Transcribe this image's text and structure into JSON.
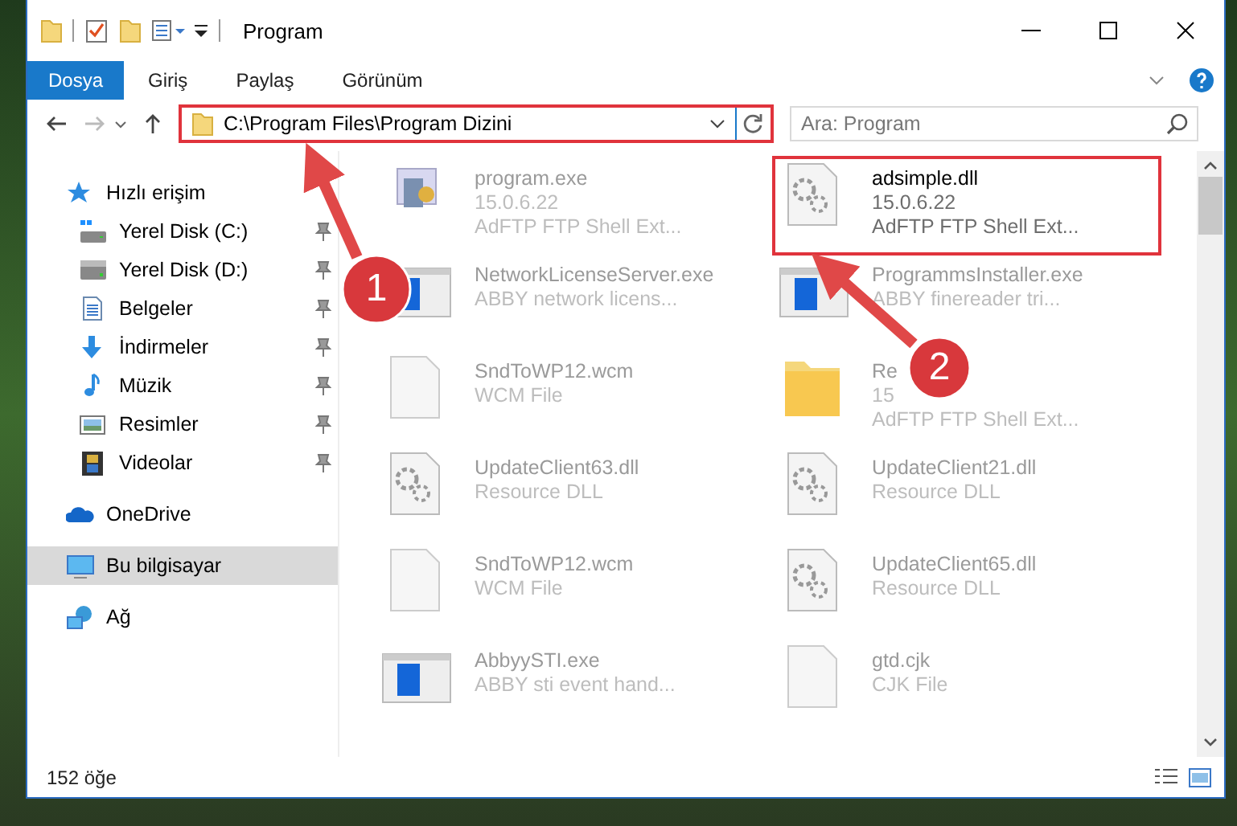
{
  "window": {
    "title": "Program"
  },
  "ribbon": {
    "tabs": [
      {
        "label": "Dosya",
        "selected": true
      },
      {
        "label": "Giriş",
        "selected": false
      },
      {
        "label": "Paylaş",
        "selected": false
      },
      {
        "label": "Görünüm",
        "selected": false
      }
    ]
  },
  "address_bar": {
    "path": "C:\\Program Files\\Program Dizini",
    "highlighted": true
  },
  "search": {
    "placeholder": "Ara: Program"
  },
  "navigation": {
    "items": [
      {
        "kind": "star",
        "label": "Hızlı erişim",
        "selected": false,
        "children": [
          {
            "kind": "drive-c",
            "label": "Yerel Disk (C:)",
            "pinned": true,
            "selected": false
          },
          {
            "kind": "drive",
            "label": "Yerel Disk (D:)",
            "pinned": true,
            "selected": false
          },
          {
            "kind": "document",
            "label": "Belgeler",
            "pinned": true,
            "selected": false
          },
          {
            "kind": "download",
            "label": "İndirmeler",
            "pinned": true,
            "selected": false
          },
          {
            "kind": "music",
            "label": "Müzik",
            "pinned": true,
            "selected": false
          },
          {
            "kind": "picture",
            "label": "Resimler",
            "pinned": true,
            "selected": false
          },
          {
            "kind": "video",
            "label": "Videolar",
            "pinned": true,
            "selected": false
          }
        ]
      },
      {
        "kind": "cloud",
        "label": "OneDrive",
        "selected": false
      },
      {
        "kind": "computer",
        "label": "Bu bilgisayar",
        "selected": true
      },
      {
        "kind": "network",
        "label": "Ağ",
        "selected": false
      }
    ]
  },
  "files": [
    {
      "kind": "program",
      "name": "program.exe",
      "details": [
        "15.0.6.22",
        "AdFTP FTP Shell Ext..."
      ],
      "faded": true,
      "highlighted": false
    },
    {
      "kind": "gear-file",
      "name": "adsimple.dll",
      "details": [
        "15.0.6.22",
        "AdFTP FTP Shell Ext..."
      ],
      "faded": false,
      "highlighted": true
    },
    {
      "kind": "app-window",
      "name": "NetworkLicenseServer.exe",
      "details": [
        "ABBY network licens..."
      ],
      "faded": true,
      "highlighted": false
    },
    {
      "kind": "app-window",
      "name": "ProgrammsInstaller.exe",
      "details": [
        "ABBY finereader tri..."
      ],
      "faded": true,
      "highlighted": false
    },
    {
      "kind": "blank-file",
      "name": "SndToWP12.wcm",
      "details": [
        "WCM File"
      ],
      "faded": true,
      "highlighted": false
    },
    {
      "kind": "folder",
      "name": "Re",
      "details": [
        "15",
        "AdFTP FTP Shell Ext..."
      ],
      "faded": true,
      "highlighted": false
    },
    {
      "kind": "gear-file",
      "name": "UpdateClient63.dll",
      "details": [
        "Resource DLL"
      ],
      "faded": true,
      "highlighted": false
    },
    {
      "kind": "gear-file",
      "name": "UpdateClient21.dll",
      "details": [
        "Resource DLL"
      ],
      "faded": true,
      "highlighted": false
    },
    {
      "kind": "blank-file",
      "name": "SndToWP12.wcm",
      "details": [
        "WCM File"
      ],
      "faded": true,
      "highlighted": false
    },
    {
      "kind": "gear-file",
      "name": "UpdateClient65.dll",
      "details": [
        "Resource DLL"
      ],
      "faded": true,
      "highlighted": false
    },
    {
      "kind": "app-window",
      "name": "AbbyySTI.exe",
      "details": [
        "ABBY sti event hand..."
      ],
      "faded": true,
      "highlighted": false
    },
    {
      "kind": "blank-file",
      "name": "gtd.cjk",
      "details": [
        "CJK File"
      ],
      "faded": true,
      "highlighted": false
    }
  ],
  "status_bar": {
    "item_count": "152 öğe"
  },
  "callouts": [
    {
      "number": "1"
    },
    {
      "number": "2"
    }
  ]
}
